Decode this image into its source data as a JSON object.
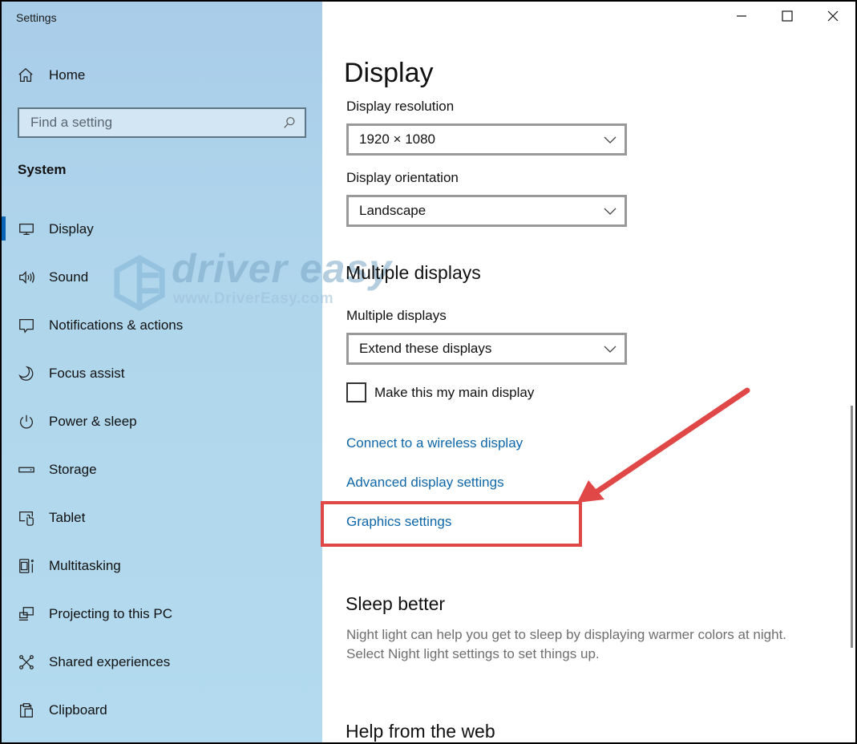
{
  "window": {
    "title": "Settings",
    "controls": {
      "minimize": "minimize-icon",
      "maximize": "maximize-icon",
      "close": "close-icon"
    }
  },
  "sidebar": {
    "home_label": "Home",
    "search_placeholder": "Find a setting",
    "section_title": "System",
    "items": [
      {
        "label": "Display",
        "icon": "monitor-icon",
        "active": true
      },
      {
        "label": "Sound",
        "icon": "speaker-icon"
      },
      {
        "label": "Notifications & actions",
        "icon": "notification-icon"
      },
      {
        "label": "Focus assist",
        "icon": "moon-icon"
      },
      {
        "label": "Power & sleep",
        "icon": "power-icon"
      },
      {
        "label": "Storage",
        "icon": "storage-icon"
      },
      {
        "label": "Tablet",
        "icon": "tablet-icon"
      },
      {
        "label": "Multitasking",
        "icon": "multitasking-icon"
      },
      {
        "label": "Projecting to this PC",
        "icon": "projecting-icon"
      },
      {
        "label": "Shared experiences",
        "icon": "shared-icon"
      },
      {
        "label": "Clipboard",
        "icon": "clipboard-icon"
      }
    ],
    "accent_color": "#0a64b4"
  },
  "watermark": {
    "brand": "driver easy",
    "url": "www.DriverEasy.com"
  },
  "content": {
    "page_title": "Display",
    "resolution": {
      "label": "Display resolution",
      "value": "1920 × 1080"
    },
    "orientation": {
      "label": "Display orientation",
      "value": "Landscape"
    },
    "multiple_displays_heading": "Multiple displays",
    "multiple_displays": {
      "label": "Multiple displays",
      "value": "Extend these displays"
    },
    "main_display_checkbox": {
      "label": "Make this my main display",
      "checked": false
    },
    "links": {
      "wireless": "Connect to a wireless display",
      "advanced": "Advanced display settings",
      "graphics": "Graphics settings"
    },
    "sleep_heading": "Sleep better",
    "sleep_desc": "Night light can help you get to sleep by displaying warmer colors at night. Select Night light settings to set things up.",
    "help_heading": "Help from the web"
  },
  "annotation": {
    "color": "#e04848",
    "target": "Graphics settings"
  }
}
